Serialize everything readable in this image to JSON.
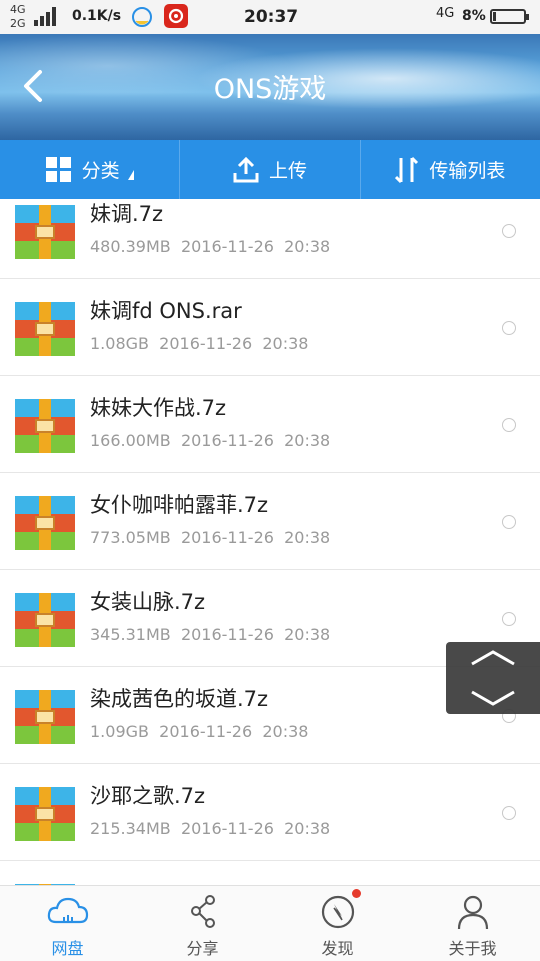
{
  "status_bar": {
    "network_top": "4G",
    "network_bottom": "2G",
    "speed": "0.1K/s",
    "time": "20:37",
    "network_right": "4G",
    "battery": "8%"
  },
  "header": {
    "title": "ONS游戏"
  },
  "toolbar": {
    "category_label": "分类",
    "upload_label": "上传",
    "transfer_label": "传输列表"
  },
  "files": [
    {
      "name": "妹调.7z",
      "size": "480.39MB",
      "date": "2016-11-26",
      "time": "20:38"
    },
    {
      "name": "妹调fd ONS.rar",
      "size": "1.08GB",
      "date": "2016-11-26",
      "time": "20:38"
    },
    {
      "name": "妹妹大作战.7z",
      "size": "166.00MB",
      "date": "2016-11-26",
      "time": "20:38"
    },
    {
      "name": "女仆咖啡帕露菲.7z",
      "size": "773.05MB",
      "date": "2016-11-26",
      "time": "20:38"
    },
    {
      "name": "女装山脉.7z",
      "size": "345.31MB",
      "date": "2016-11-26",
      "time": "20:38"
    },
    {
      "name": "染成茜色的坂道.7z",
      "size": "1.09GB",
      "date": "2016-11-26",
      "time": "20:38"
    },
    {
      "name": "沙耶之歌.7z",
      "size": "215.34MB",
      "date": "2016-11-26",
      "time": "20:38"
    }
  ],
  "bottom_nav": [
    {
      "label": "网盘",
      "icon": "cloud-icon",
      "active": true
    },
    {
      "label": "分享",
      "icon": "share-icon",
      "active": false
    },
    {
      "label": "发现",
      "icon": "compass-icon",
      "active": false
    },
    {
      "label": "关于我",
      "icon": "person-icon",
      "active": false
    }
  ],
  "colors": {
    "accent": "#2990e6",
    "badge": "#e53b2c"
  }
}
